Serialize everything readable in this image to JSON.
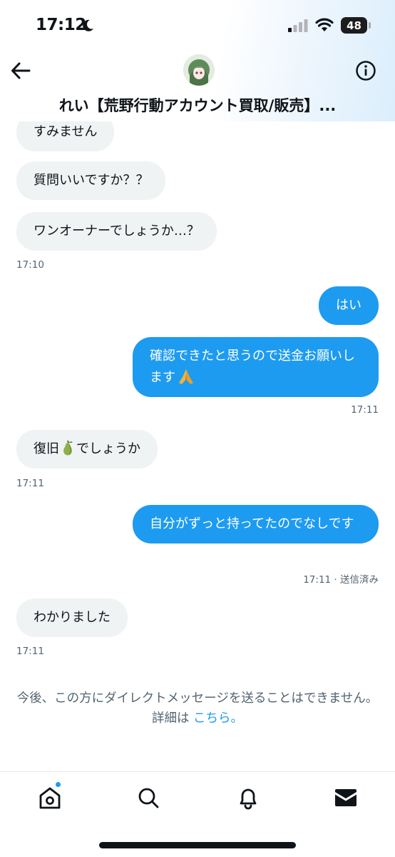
{
  "status_bar": {
    "time": "17:12",
    "battery": "48"
  },
  "header": {
    "title": "れい【荒野行動アカウント買取/販売】..."
  },
  "messages": [
    {
      "dir": "received",
      "text": "すみません"
    },
    {
      "dir": "received",
      "text": "質問いいですか？？"
    },
    {
      "dir": "received",
      "text": "ワンオーナーでしょうか…？"
    },
    {
      "dir": "received_time",
      "text": "17:10"
    },
    {
      "dir": "sent",
      "text": "はい"
    },
    {
      "dir": "sent",
      "text": "確認できたと思うので送金お願いします",
      "emoji": "folded-hands"
    },
    {
      "dir": "sent_time",
      "text": "17:11"
    },
    {
      "dir": "received",
      "text_before": "復旧",
      "emoji": "pear",
      "text_after": "でしょうか"
    },
    {
      "dir": "received_time",
      "text": "17:11"
    },
    {
      "dir": "sent",
      "text": "自分がずっと持ってたのでなしです"
    },
    {
      "dir": "sent_time",
      "text": "17:11 · 送信済み"
    },
    {
      "dir": "received",
      "text": "わかりました"
    },
    {
      "dir": "received_time",
      "text": "17:11"
    }
  ],
  "notice": {
    "text": "今後、この方にダイレクトメッセージを送ることはできません。詳細は ",
    "link": "こちら。"
  },
  "nav": {
    "items": [
      "home-icon",
      "search-icon",
      "notifications-icon",
      "messages-icon"
    ],
    "active": "messages-icon",
    "home_badge": true
  },
  "colors": {
    "accent": "#1d9bf0",
    "received_bubble": "#eff3f4",
    "secondary_text": "#536471"
  }
}
